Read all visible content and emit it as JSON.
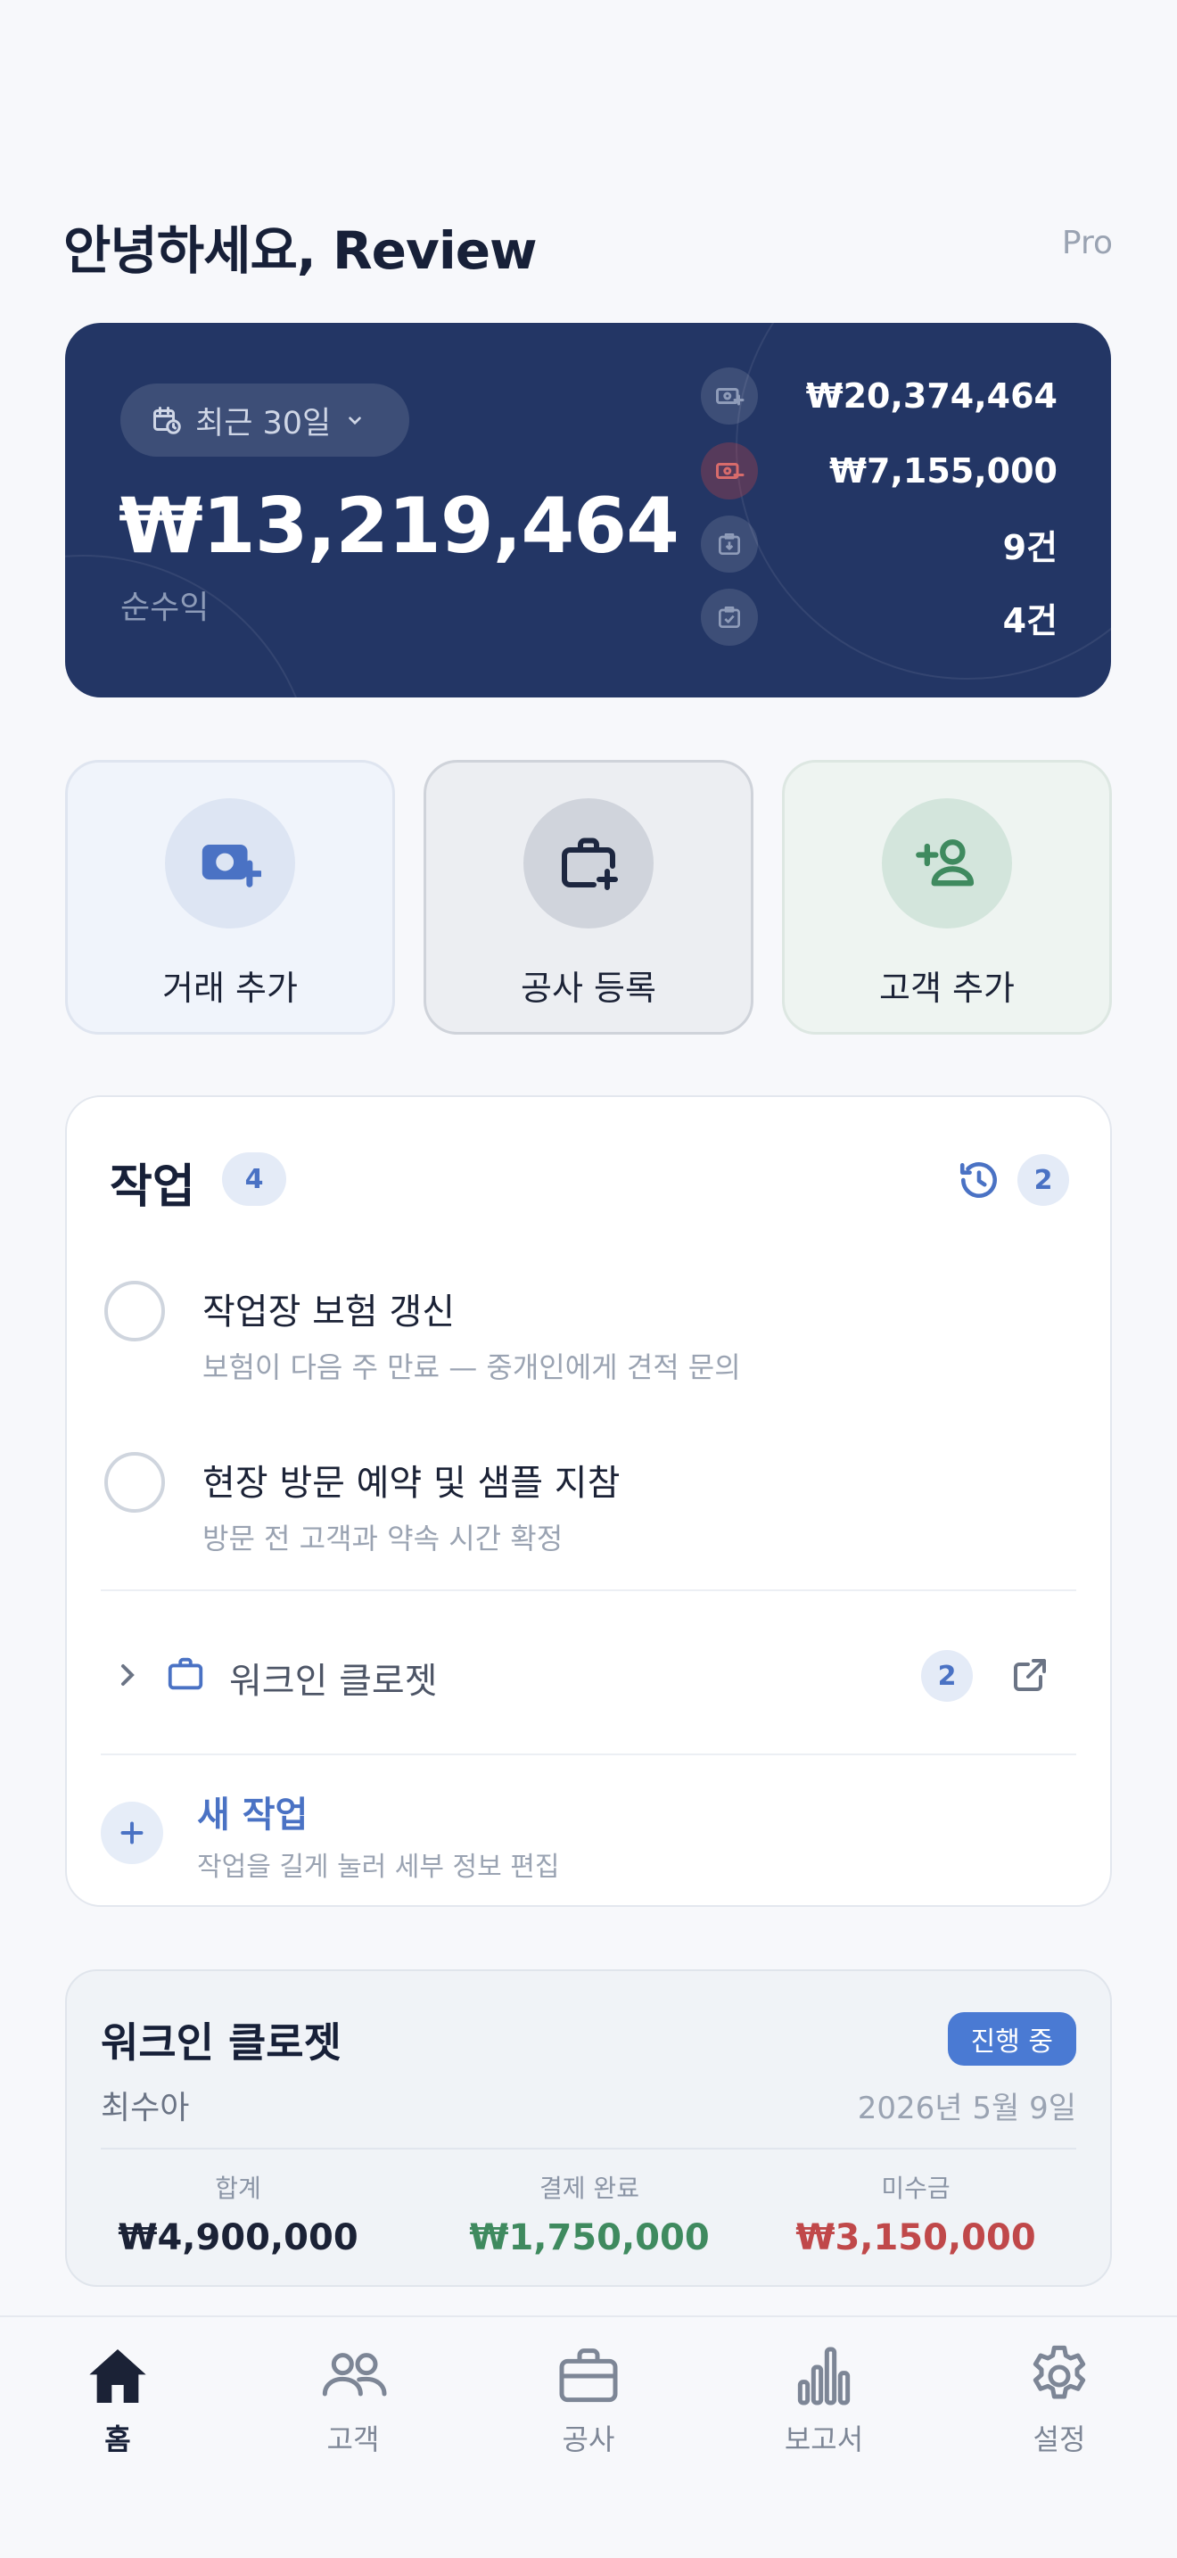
{
  "header": {
    "greeting": "안녕하세요, Review",
    "plan_badge": "Pro"
  },
  "summary": {
    "period": "최근 30일",
    "net_amount": "₩13,219,464",
    "net_label": "순수익",
    "stats": [
      {
        "icon": "income-icon",
        "value": "₩20,374,464"
      },
      {
        "icon": "expense-icon",
        "value": "₩7,155,000"
      },
      {
        "icon": "inbox-tray-icon",
        "value": "9건"
      },
      {
        "icon": "clipboard-check-icon",
        "value": "4건"
      }
    ]
  },
  "quick_actions": [
    {
      "label": "거래 추가",
      "icon": "add-transaction-icon"
    },
    {
      "label": "공사 등록",
      "icon": "add-project-icon"
    },
    {
      "label": "고객 추가",
      "icon": "add-customer-icon"
    }
  ],
  "tasks": {
    "title": "작업",
    "count": "4",
    "history_count": "2",
    "items": [
      {
        "title": "작업장 보험 갱신",
        "subtitle": "보험이 다음 주 만료 — 중개인에게 견적 문의"
      },
      {
        "title": "현장 방문 예약 및 샘플 지참",
        "subtitle": "방문 전 고객과 약속 시간 확정"
      }
    ],
    "project_group": {
      "name": "워크인 클로젯",
      "count": "2"
    },
    "new_task": {
      "title": "새 작업",
      "hint": "작업을 길게 눌러 세부 정보 편집"
    }
  },
  "project_card": {
    "name": "워크인 클로젯",
    "status": "진행 중",
    "client": "최수아",
    "date": "2026년 5월 9일",
    "totals": [
      {
        "label": "합계",
        "value": "₩4,900,000",
        "color": "#1b2236"
      },
      {
        "label": "결제 완료",
        "value": "₩1,750,000",
        "color": "#3f8a5f"
      },
      {
        "label": "미수금",
        "value": "₩3,150,000",
        "color": "#c0484a"
      }
    ]
  },
  "tabbar": {
    "items": [
      {
        "label": "홈",
        "icon": "home-icon",
        "active": true
      },
      {
        "label": "고객",
        "icon": "people-icon",
        "active": false
      },
      {
        "label": "공사",
        "icon": "briefcase-icon",
        "active": false
      },
      {
        "label": "보고서",
        "icon": "bar-chart-icon",
        "active": false
      },
      {
        "label": "설정",
        "icon": "gear-icon",
        "active": false
      }
    ]
  },
  "colors": {
    "accent": "#4a72c4",
    "card_navy": "#233665",
    "paid_green": "#3f8a5f",
    "due_red": "#c0484a"
  }
}
